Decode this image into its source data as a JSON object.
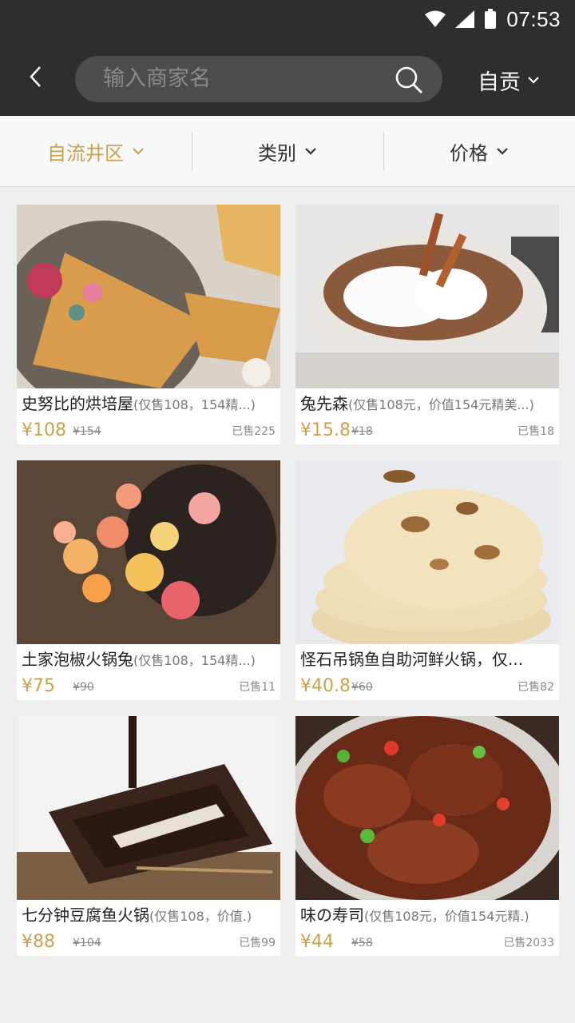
{
  "status": {
    "time": "07:53"
  },
  "header": {
    "search_placeholder": "输入商家名",
    "city": "自贡"
  },
  "filters": [
    {
      "label": "自流井区",
      "active": true
    },
    {
      "label": "类别",
      "active": false
    },
    {
      "label": "价格",
      "active": false
    }
  ],
  "colors": {
    "accent": "#c9a24a",
    "header_bg": "#2e2e2e"
  },
  "items": [
    {
      "name": "史努比的烘培屋",
      "note": "(仅售108，154精...)",
      "price": "¥108",
      "original": "¥154",
      "sold": "已售225"
    },
    {
      "name": "兔先森",
      "note": "(仅售108元，价值154元精美...)",
      "price": "¥15.8",
      "original": "¥18",
      "sold": "已售18"
    },
    {
      "name": "土家泡椒火锅兔",
      "note": "(仅售108，154精...)",
      "price": "¥75",
      "original": "¥90",
      "sold": "已售11"
    },
    {
      "name": "怪石吊锅鱼自助河鲜火锅，仅...",
      "note": "",
      "price": "¥40.8",
      "original": "¥60",
      "sold": "已售82"
    },
    {
      "name": "七分钟豆腐鱼火锅",
      "note": "(仅售108，价值.)",
      "price": "¥88",
      "original": "¥104",
      "sold": "已售99"
    },
    {
      "name": "味の寿司",
      "note": "(仅售108元，价值154元精.)",
      "price": "¥44",
      "original": "¥58",
      "sold": "已售2033"
    }
  ]
}
